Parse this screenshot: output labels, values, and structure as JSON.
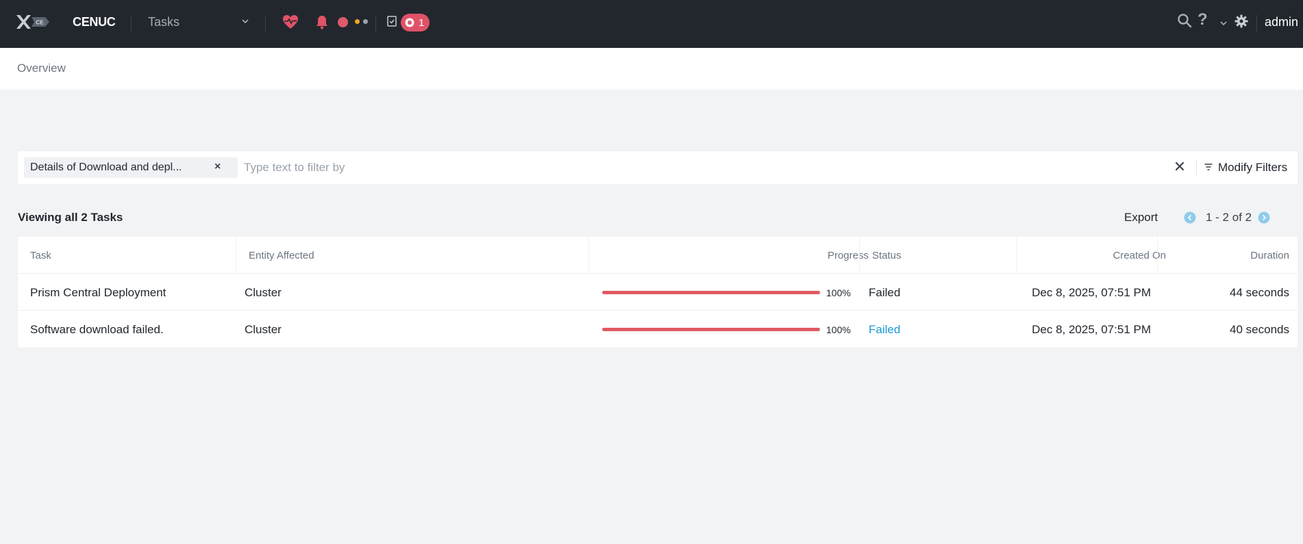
{
  "header": {
    "logo_mark": "CE",
    "cluster_name": "CENUC",
    "nav_selected": "Tasks",
    "running_tasks_count": "1",
    "help_glyph": "?",
    "user_label": "admin",
    "colors": {
      "bar": "#22272e",
      "alert": "#e05267",
      "warning": "#f3a51f"
    }
  },
  "breadcrumb": {
    "label": "Overview"
  },
  "filter": {
    "chip_label": "Details of Download and depl...",
    "chip_close": "×",
    "placeholder": "Type text to filter by",
    "modify_label": "Modify Filters"
  },
  "results": {
    "summary": "Viewing all 2 Tasks",
    "export_label": "Export",
    "page_range": "1 - 2 of 2"
  },
  "table": {
    "columns": {
      "task": "Task",
      "entity": "Entity Affected",
      "progress": "Progress",
      "status": "Status",
      "created": "Created On",
      "duration": "Duration"
    },
    "rows": [
      {
        "task": "Prism Central Deployment",
        "entity": "Cluster",
        "progress": 100,
        "progress_label": "100%",
        "status": "Failed",
        "created": "Dec 8, 2025, 07:51 PM",
        "duration": "44 seconds"
      },
      {
        "task": "Software download failed.",
        "entity": "Cluster",
        "progress": 100,
        "progress_label": "100%",
        "status": "Failed",
        "created": "Dec 8, 2025, 07:51 PM",
        "duration": "40 seconds"
      }
    ],
    "colors": {
      "progress_failed": "#e05a62",
      "link": "#1b9bd3"
    }
  }
}
